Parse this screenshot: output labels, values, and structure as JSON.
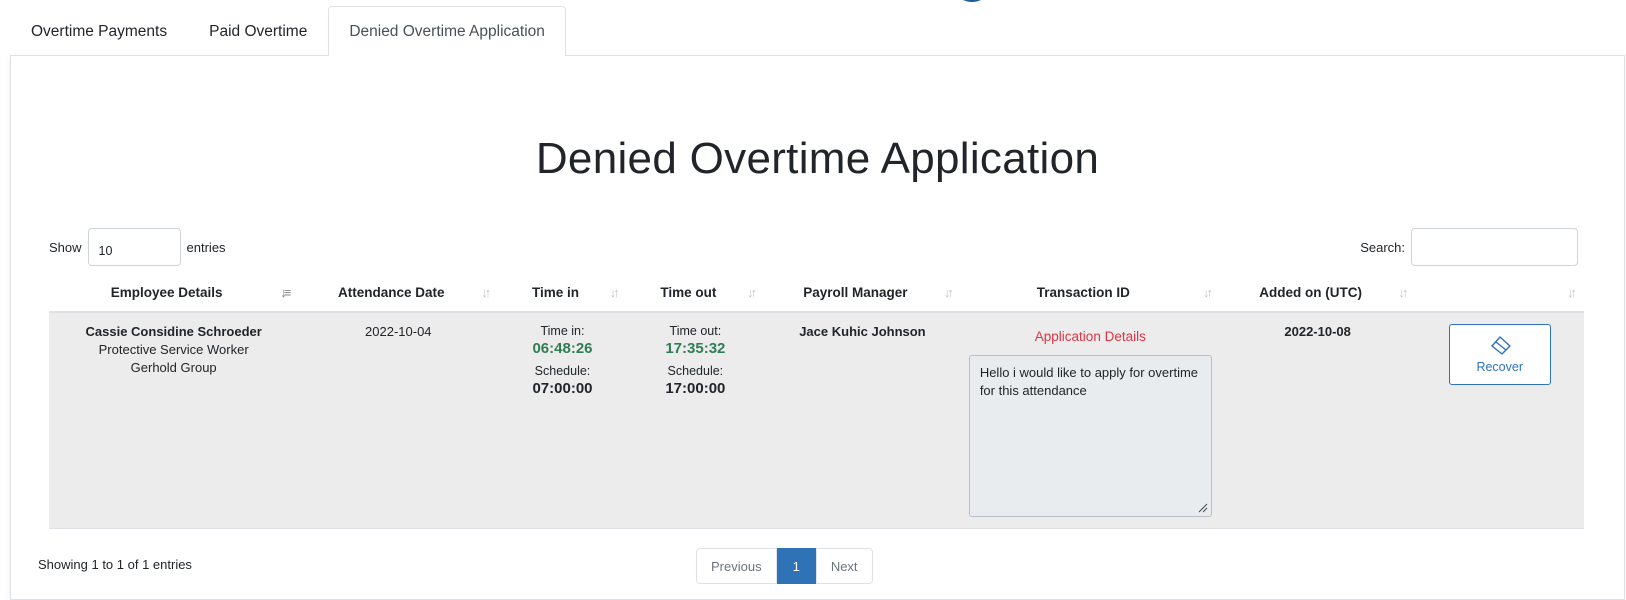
{
  "tabs": [
    {
      "label": "Overtime Payments"
    },
    {
      "label": "Paid Overtime"
    },
    {
      "label": "Denied Overtime Application"
    }
  ],
  "page_title": "Denied Overtime Application",
  "length": {
    "prefix": "Show",
    "value": "10",
    "suffix": "entries"
  },
  "search": {
    "label": "Search:",
    "value": ""
  },
  "columns": [
    {
      "label": "Employee Details"
    },
    {
      "label": "Attendance Date"
    },
    {
      "label": "Time in"
    },
    {
      "label": "Time out"
    },
    {
      "label": "Payroll Manager"
    },
    {
      "label": "Transaction ID"
    },
    {
      "label": "Added on (UTC)"
    },
    {
      "label": ""
    }
  ],
  "rows": [
    {
      "employee_name": "Cassie Considine Schroeder",
      "employee_position": "Protective Service Worker",
      "employee_company": "Gerhold Group",
      "attendance_date": "2022-10-04",
      "time_in_label": "Time in:",
      "time_in": "06:48:26",
      "time_in_schedule_label": "Schedule:",
      "time_in_schedule": "07:00:00",
      "time_out_label": "Time out:",
      "time_out": "17:35:32",
      "time_out_schedule_label": "Schedule:",
      "time_out_schedule": "17:00:00",
      "payroll_manager": "Jace Kuhic Johnson",
      "application_link": "Application Details",
      "application_note": "Hello i would like to apply for overtime for this attendance",
      "added_on": "2022-10-08",
      "action_label": "Recover"
    }
  ],
  "footer_info": "Showing 1 to 1 of 1 entries",
  "pagination": {
    "previous": "Previous",
    "current": "1",
    "next": "Next"
  },
  "colors": {
    "accent": "#2f72b5",
    "time_green": "#2e7d55",
    "link_red": "#dc3545"
  },
  "icons": {
    "recover": "eraser-icon",
    "sort": "sort-arrows-icon"
  }
}
